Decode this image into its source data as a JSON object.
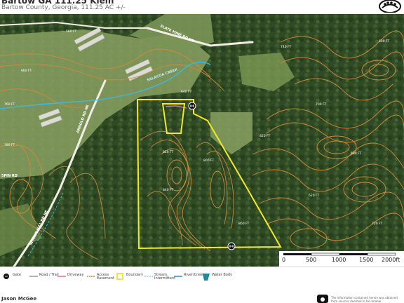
{
  "header": {
    "title": "Bartow GA 111.25 Klein",
    "subtitle": "Bartow County, Georgia, 111.25 AC +/-"
  },
  "map": {
    "contour_labels": [
      "560 FT",
      "600 FT",
      "620 FT",
      "640 FT",
      "660 FT",
      "680 FT",
      "700 FT",
      "720 FT",
      "740 FT",
      "760 FT",
      "780 FT",
      "800 FT",
      "820 FT",
      "840 FT",
      "860 FT"
    ],
    "road_labels": [
      "SLATE MINE RD NE",
      "ARNOLD RD NE",
      "SPRING HILL RD NE",
      "SALACOA CREEK",
      "5PIN RD"
    ],
    "colors": {
      "boundary": "#f2ea22",
      "contour": "#d48a3a",
      "creek": "#3cb8e6",
      "driveway": "#e36aa8",
      "road": "#f2ede4",
      "forest": "#2f4a24",
      "pasture": "#8aa062"
    }
  },
  "scale": {
    "ticks": [
      "0",
      "500",
      "1000",
      "1500",
      "2000ft"
    ]
  },
  "legend": {
    "items": [
      {
        "label": "Gate",
        "icon": "gate-icon"
      },
      {
        "label": "Road / Trail",
        "icon": "road-line-icon"
      },
      {
        "label": "Driveway",
        "icon": "driveway-line-icon"
      },
      {
        "label": "Access Easement",
        "icon": "easement-line-icon"
      },
      {
        "label": "Boundary",
        "icon": "boundary-icon"
      },
      {
        "label": "Stream, Intermittent",
        "icon": "stream-icon"
      },
      {
        "label": "River/Creek",
        "icon": "river-icon"
      },
      {
        "label": "Water Body",
        "icon": "water-body-icon"
      }
    ]
  },
  "footer": {
    "agent": "Jason McGee",
    "disclaimer": "The information contained herein was obtained from sources deemed to be reliable."
  }
}
